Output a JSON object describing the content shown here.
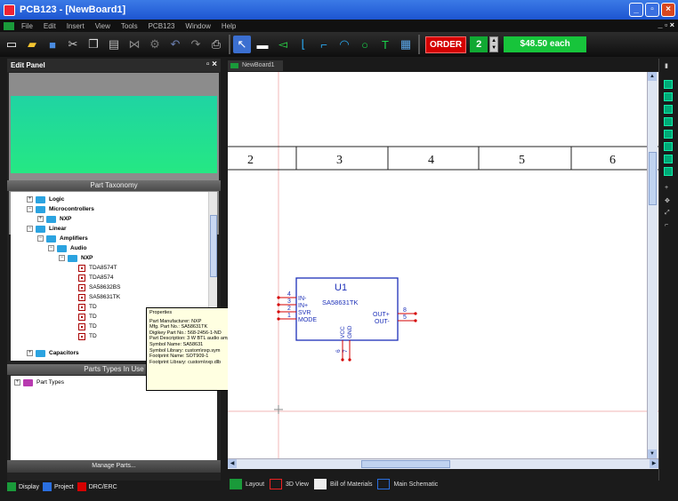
{
  "window": {
    "title": "PCB123 - [NewBoard1]"
  },
  "menu": [
    "File",
    "Edit",
    "Insert",
    "View",
    "Tools",
    "PCB123",
    "Window",
    "Help"
  ],
  "toolbar": {
    "order_label": "ORDER",
    "quantity": "2",
    "price": "$48.50 each"
  },
  "edit_panel": {
    "title": "Edit Panel",
    "taxonomy_header": "Part Taxonomy",
    "types_header": "Parts Types In Use",
    "manage_button": "Manage Parts...",
    "tree": [
      {
        "label": "Logic",
        "bold": true
      },
      {
        "label": "Microcontrollers",
        "bold": true
      },
      {
        "label": "NXP",
        "bold": true
      },
      {
        "label": "Linear",
        "bold": true
      },
      {
        "label": "Amplifiers",
        "bold": true
      },
      {
        "label": "Audio",
        "bold": true
      },
      {
        "label": "NXP",
        "bold": true
      },
      {
        "label": "TDA8574T"
      },
      {
        "label": "TDA8574"
      },
      {
        "label": "SA58632BS"
      },
      {
        "label": "SA58631TK"
      },
      {
        "label": "TD"
      },
      {
        "label": "TD"
      },
      {
        "label": "TD"
      },
      {
        "label": "TD"
      },
      {
        "label": "Capacitors",
        "bold": true
      }
    ],
    "types_tree": [
      {
        "label": "Part Types"
      }
    ]
  },
  "tooltip": {
    "heading": "Properties",
    "lines": [
      "Part Manufacturer: NXP",
      "Mfg. Part No.: SA58631TK",
      "Digikey Part No.: 568-2456-1-ND",
      "Part Description: 3 W BTL audio amplifier",
      "Symbol Name: SA58631",
      "Symbol Library: custom\\nxp.sym",
      "Footprint Name: SOT909-1",
      "Footprint Library: custom\\nxp.dlb"
    ]
  },
  "left_tabs": [
    "Display",
    "Project",
    "DRC/ERC"
  ],
  "document_tab": "NewBoard1",
  "schematic": {
    "columns": [
      "2",
      "3",
      "4",
      "5",
      "6"
    ],
    "component": {
      "ref": "U1",
      "value": "SA58631TK",
      "pins_left": [
        {
          "num": "4",
          "name": "IN-"
        },
        {
          "num": "3",
          "name": "IN+"
        },
        {
          "num": "2",
          "name": "SVR"
        },
        {
          "num": "1",
          "name": "MODE"
        }
      ],
      "pins_right": [
        {
          "num": "8",
          "name": "OUT+"
        },
        {
          "num": "5",
          "name": "OUT-"
        }
      ],
      "pins_bottom": [
        {
          "num": "6",
          "name": "VCC"
        },
        {
          "num": "7",
          "name": "GND"
        }
      ]
    }
  },
  "bottom_tabs": [
    "Layout",
    "3D View",
    "Bill of Materials",
    "Main Schematic"
  ],
  "colors": {
    "accent_green": "#17c43b",
    "order_red": "#d40000",
    "wire_red": "#d40000",
    "symbol_blue": "#1c2fb8"
  }
}
